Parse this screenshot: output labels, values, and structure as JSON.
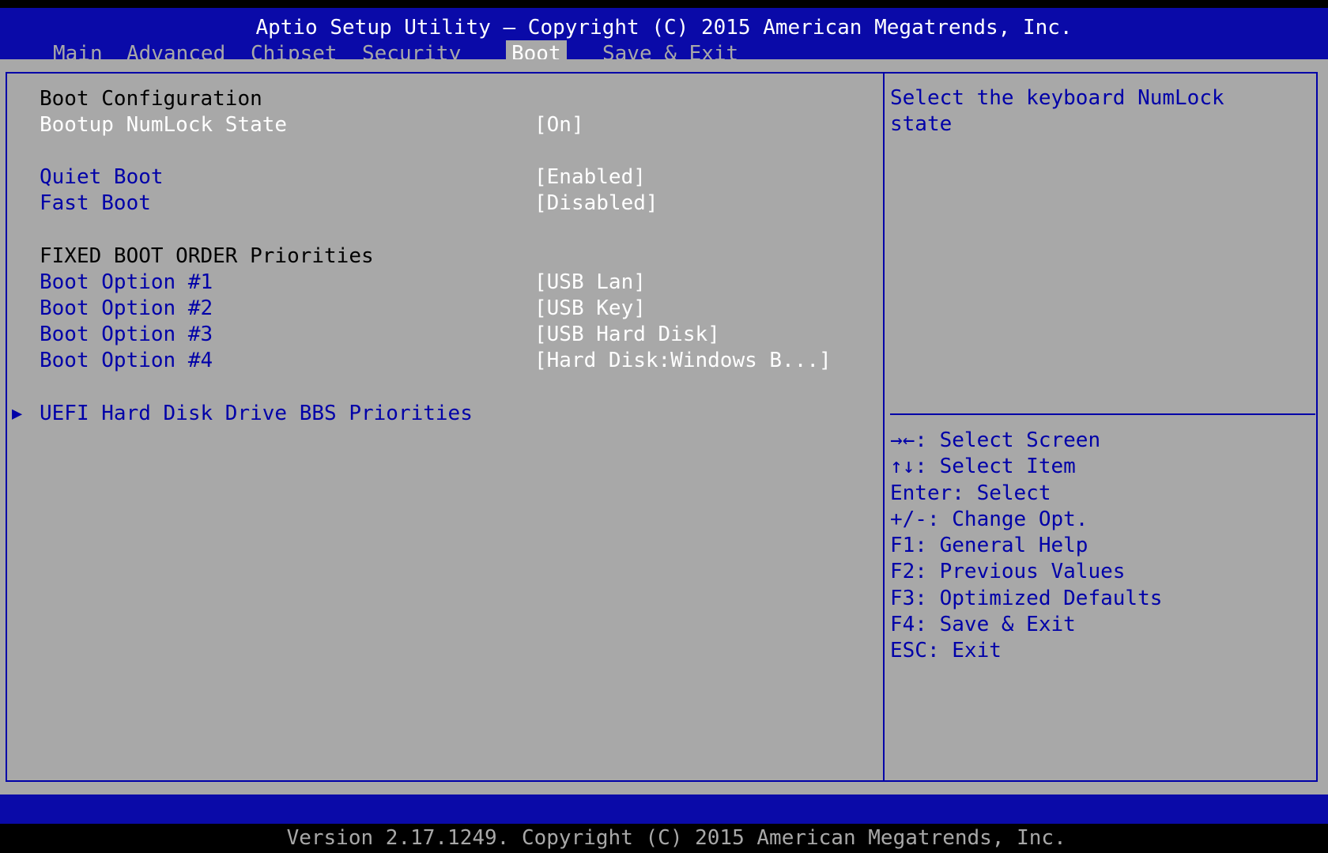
{
  "header": {
    "title": "Aptio Setup Utility – Copyright (C) 2015 American Megatrends, Inc.",
    "tabs": [
      "Main",
      "Advanced",
      "Chipset",
      "Security",
      "Boot",
      "Save & Exit"
    ],
    "active_tab": "Boot"
  },
  "boot": {
    "config_header": "Boot Configuration",
    "numlock": {
      "label": "Bootup NumLock State",
      "value": "[On]"
    },
    "quiet_boot": {
      "label": "Quiet Boot",
      "value": "[Enabled]"
    },
    "fast_boot": {
      "label": "Fast Boot",
      "value": "[Disabled]"
    },
    "order_header": "FIXED BOOT ORDER Priorities",
    "options": [
      {
        "label": "Boot Option #1",
        "value": "[USB Lan]"
      },
      {
        "label": "Boot Option #2",
        "value": "[USB Key]"
      },
      {
        "label": "Boot Option #3",
        "value": "[USB Hard Disk]"
      },
      {
        "label": "Boot Option #4",
        "value": "[Hard Disk:Windows B...]"
      }
    ],
    "submenu": "UEFI Hard Disk Drive BBS Priorities"
  },
  "help": {
    "text": "Select the keyboard NumLock\nstate"
  },
  "keys": [
    "→←: Select Screen",
    "↑↓: Select Item",
    "Enter: Select",
    "+/-: Change Opt.",
    "F1: General Help",
    "F2: Previous Values",
    "F3: Optimized Defaults",
    "F4: Save & Exit",
    "ESC: Exit"
  ],
  "footer": {
    "version": "Version 2.17.1249. Copyright (C) 2015 American Megatrends, Inc."
  },
  "colors": {
    "bar_blue": "#0a0aa8",
    "panel_gray": "#a8a8a8",
    "text_blue": "#0000a8",
    "highlight_white": "#ffffff"
  }
}
